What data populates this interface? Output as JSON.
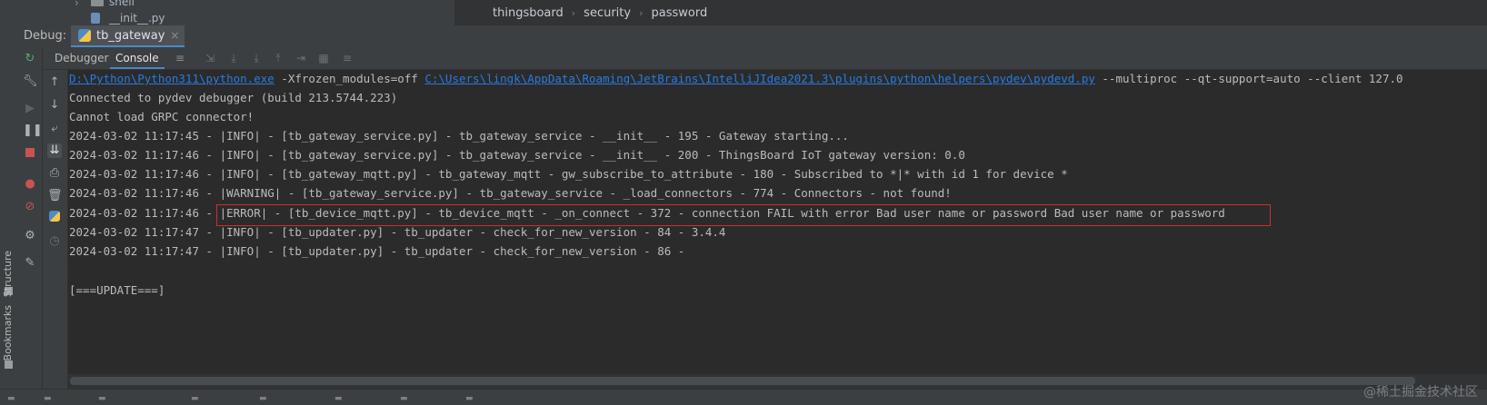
{
  "project_tree": {
    "folder_label": "shell",
    "file_label": "__init__.py"
  },
  "breadcrumb": [
    "thingsboard",
    "security",
    "password"
  ],
  "debug": {
    "label": "Debug:",
    "session_tab": "tb_gateway"
  },
  "tool_tabs": {
    "debugger": "Debugger",
    "console": "Console"
  },
  "side_labels": {
    "structure": "Structure",
    "bookmarks": "Bookmarks"
  },
  "console": {
    "command": {
      "exe_path": "D:\\Python\\Python311\\python.exe",
      "args1": " -Xfrozen_modules=off ",
      "pydevd_path": "C:\\Users\\lingk\\AppData\\Roaming\\JetBrains\\IntelliJIdea2021.3\\plugins\\python\\helpers\\pydev\\pydevd.py",
      "args2": " --multiproc --qt-support=auto --client 127.0"
    },
    "lines": [
      "Connected to pydev debugger (build 213.5744.223)",
      "Cannot load GRPC connector!",
      "2024-03-02 11:17:45 - |INFO| - [tb_gateway_service.py] - tb_gateway_service - __init__ - 195 - Gateway starting...",
      "2024-03-02 11:17:46 - |INFO| - [tb_gateway_service.py] - tb_gateway_service - __init__ - 200 - ThingsBoard IoT gateway version: 0.0",
      "2024-03-02 11:17:46 - |INFO| - [tb_gateway_mqtt.py] - tb_gateway_mqtt - gw_subscribe_to_attribute - 180 - Subscribed to *|* with id 1 for device *",
      "2024-03-02 11:17:46 - |WARNING| - [tb_gateway_service.py] - tb_gateway_service - _load_connectors - 774 - Connectors - not found!",
      "2024-03-02 11:17:46 - |ERROR| - [tb_device_mqtt.py] - tb_device_mqtt - _on_connect - 372 - connection FAIL with error Bad user name or password Bad user name or password",
      "2024-03-02 11:17:47 - |INFO| - [tb_updater.py] - tb_updater - check_for_new_version - 84 - 3.4.4",
      "2024-03-02 11:17:47 - |INFO| - [tb_updater.py] - tb_updater - check_for_new_version - 86 -",
      "",
      "[===UPDATE===]"
    ]
  },
  "watermark": "@稀土掘金技术社区",
  "colors": {
    "accent": "#4a88c7",
    "link": "#287bde",
    "error_box": "#cc2f2f",
    "console_bg": "#2b2b2b"
  }
}
